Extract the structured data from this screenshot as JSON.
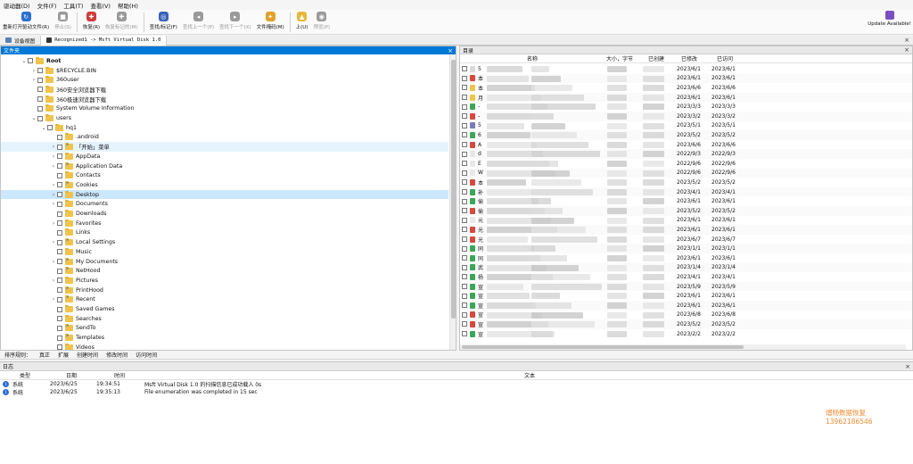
{
  "menu": [
    "驱动器(D)",
    "文件(F)",
    "工具(T)",
    "查看(V)",
    "帮助(H)"
  ],
  "toolbar": [
    {
      "label": "重新打开驱动文件(R)",
      "icon": "refresh-icon",
      "color": "#2a6fd1",
      "enabled": true
    },
    {
      "label": "停止(S)",
      "icon": "stop-icon",
      "color": "#9a9a9a",
      "enabled": false
    },
    {
      "label": "恢复(R)",
      "icon": "recover-icon",
      "color": "#d23b3b",
      "enabled": true
    },
    {
      "label": "恢复标记的(M)",
      "icon": "recover-marked-icon",
      "color": "#9a9a9a",
      "enabled": false
    },
    {
      "label": "查找/标记(F)",
      "icon": "binoculars-icon",
      "color": "#3a62b8",
      "enabled": true
    },
    {
      "label": "查找上一个(P)",
      "icon": "find-prev-icon",
      "color": "#9a9a9a",
      "enabled": false
    },
    {
      "label": "查找下一个(X)",
      "icon": "find-next-icon",
      "color": "#9a9a9a",
      "enabled": false
    },
    {
      "label": "文件掩码(M)",
      "icon": "file-mask-icon",
      "color": "#e0a22c",
      "enabled": true
    },
    {
      "label": "上(U)",
      "icon": "folder-up-icon",
      "color": "#e8b83c",
      "enabled": true
    },
    {
      "label": "预览(P)",
      "icon": "preview-icon",
      "color": "#9a9a9a",
      "enabled": false
    }
  ],
  "update_label": "Update Available!",
  "tabs": [
    {
      "label": "设备视图",
      "active": false
    },
    {
      "label": "Recognized1 -> Msft Virtual Disk 1.0",
      "active": true
    }
  ],
  "tree": {
    "title": "文件夹",
    "rows": [
      {
        "label": "Root",
        "level": 0,
        "arrow": "⌄",
        "bold": true
      },
      {
        "label": "$RECYCLE.BIN",
        "level": 1,
        "arrow": "›"
      },
      {
        "label": "360user",
        "level": 1,
        "arrow": "›"
      },
      {
        "label": "360安全浏览器下载",
        "level": 1,
        "arrow": ""
      },
      {
        "label": "360极速浏览器下载",
        "level": 1,
        "arrow": ""
      },
      {
        "label": "System Volume Information",
        "level": 1,
        "arrow": ""
      },
      {
        "label": "users",
        "level": 1,
        "arrow": "⌄"
      },
      {
        "label": "hq1",
        "level": 2,
        "arrow": "⌄"
      },
      {
        "label": ".android",
        "level": 3,
        "arrow": ""
      },
      {
        "label": "「开始」菜单",
        "level": 3,
        "arrow": "›",
        "state": "hov",
        "link": true
      },
      {
        "label": "AppData",
        "level": 3,
        "arrow": "›"
      },
      {
        "label": "Application Data",
        "level": 3,
        "arrow": "›",
        "link": true
      },
      {
        "label": "Contacts",
        "level": 3,
        "arrow": ""
      },
      {
        "label": "Cookies",
        "level": 3,
        "arrow": "›",
        "link": true
      },
      {
        "label": "Desktop",
        "level": 3,
        "arrow": "›",
        "state": "sel"
      },
      {
        "label": "Documents",
        "level": 3,
        "arrow": "›"
      },
      {
        "label": "Downloads",
        "level": 3,
        "arrow": ""
      },
      {
        "label": "Favorites",
        "level": 3,
        "arrow": "›"
      },
      {
        "label": "Links",
        "level": 3,
        "arrow": ""
      },
      {
        "label": "Local Settings",
        "level": 3,
        "arrow": "›",
        "link": true
      },
      {
        "label": "Music",
        "level": 3,
        "arrow": ""
      },
      {
        "label": "My Documents",
        "level": 3,
        "arrow": "›",
        "link": true
      },
      {
        "label": "NetHood",
        "level": 3,
        "arrow": "",
        "link": true
      },
      {
        "label": "Pictures",
        "level": 3,
        "arrow": "›"
      },
      {
        "label": "PrintHood",
        "level": 3,
        "arrow": "",
        "link": true
      },
      {
        "label": "Recent",
        "level": 3,
        "arrow": "›",
        "link": true
      },
      {
        "label": "Saved Games",
        "level": 3,
        "arrow": ""
      },
      {
        "label": "Searches",
        "level": 3,
        "arrow": ""
      },
      {
        "label": "SendTo",
        "level": 3,
        "arrow": "",
        "link": true
      },
      {
        "label": "Templates",
        "level": 3,
        "arrow": "",
        "link": true
      },
      {
        "label": "Videos",
        "level": 3,
        "arrow": ""
      }
    ]
  },
  "files": {
    "title": "目录",
    "columns": {
      "name": "名称",
      "size": "大小，字节",
      "created": "已创建",
      "modified": "已修改",
      "accessed": "已访问"
    },
    "rows": [
      {
        "initial": "5",
        "icon": "#d9d9d9",
        "modified": "2023/6/1",
        "accessed": "2023/6/1"
      },
      {
        "initial": "本",
        "icon": "#d8483c",
        "modified": "2023/6/1",
        "accessed": "2023/6/1"
      },
      {
        "initial": "本",
        "icon": "#f0c44c",
        "modified": "2023/6/6",
        "accessed": "2023/6/6"
      },
      {
        "initial": "月",
        "icon": "#f0c44c",
        "modified": "2023/6/1",
        "accessed": "2023/6/1"
      },
      {
        "initial": "-",
        "icon": "#3aa657",
        "modified": "2023/3/3",
        "accessed": "2023/3/3"
      },
      {
        "initial": "-",
        "icon": "#d8483c",
        "modified": "2023/3/2",
        "accessed": "2023/3/2"
      },
      {
        "initial": "5",
        "icon": "#7a7ab8",
        "modified": "2023/5/1",
        "accessed": "2023/5/1"
      },
      {
        "initial": "6",
        "icon": "#3aa657",
        "modified": "2023/5/2",
        "accessed": "2023/5/2"
      },
      {
        "initial": "A",
        "icon": "#d8483c",
        "modified": "2023/6/6",
        "accessed": "2023/6/6"
      },
      {
        "initial": "d",
        "icon": "#e8e8e8",
        "modified": "2022/9/3",
        "accessed": "2022/9/3"
      },
      {
        "initial": "E",
        "icon": "#e8e8e8",
        "modified": "2022/9/6",
        "accessed": "2022/9/6"
      },
      {
        "initial": "W",
        "icon": "#e8e8e8",
        "modified": "2022/9/6",
        "accessed": "2022/9/6"
      },
      {
        "initial": "本",
        "icon": "#d8483c",
        "modified": "2023/5/2",
        "accessed": "2023/5/2"
      },
      {
        "initial": "补",
        "icon": "#3aa657",
        "modified": "2023/4/1",
        "accessed": "2023/4/1"
      },
      {
        "initial": "偷",
        "icon": "#3aa657",
        "modified": "2023/6/1",
        "accessed": "2023/6/1"
      },
      {
        "initial": "偷",
        "icon": "#d8483c",
        "modified": "2023/5/2",
        "accessed": "2023/5/2"
      },
      {
        "initial": "元",
        "icon": "#e8e8e8",
        "modified": "2023/6/1",
        "accessed": "2023/6/1"
      },
      {
        "initial": "光",
        "icon": "#d8483c",
        "modified": "2023/6/1",
        "accessed": "2023/6/1"
      },
      {
        "initial": "光",
        "icon": "#d8483c",
        "modified": "2023/6/7",
        "accessed": "2023/6/7"
      },
      {
        "initial": "同",
        "icon": "#3aa657",
        "modified": "2023/1/1",
        "accessed": "2023/1/1"
      },
      {
        "initial": "同",
        "icon": "#3aa657",
        "modified": "2023/6/1",
        "accessed": "2023/6/1"
      },
      {
        "initial": "武",
        "icon": "#3aa657",
        "modified": "2023/1/4",
        "accessed": "2023/1/4"
      },
      {
        "initial": "杨",
        "icon": "#3aa657",
        "modified": "2023/4/1",
        "accessed": "2023/4/1"
      },
      {
        "initial": "宣",
        "icon": "#3aa657",
        "modified": "2023/5/9",
        "accessed": "2023/5/9"
      },
      {
        "initial": "宣",
        "icon": "#3aa657",
        "modified": "2023/6/1",
        "accessed": "2023/6/1"
      },
      {
        "initial": "宣",
        "icon": "#3aa657",
        "modified": "2023/6/1",
        "accessed": "2023/6/1"
      },
      {
        "initial": "宣",
        "icon": "#d8483c",
        "modified": "2023/6/8",
        "accessed": "2023/6/8"
      },
      {
        "initial": "宣",
        "icon": "#d8483c",
        "modified": "2023/5/2",
        "accessed": "2023/5/2"
      },
      {
        "initial": "宣",
        "icon": "#3aa657",
        "modified": "2023/2/2",
        "accessed": "2023/2/2"
      }
    ]
  },
  "sort": {
    "label": "排序规则：",
    "options": [
      "真正",
      "扩展",
      "创建时间",
      "修改时间",
      "访问时间"
    ]
  },
  "log": {
    "title": "日志",
    "columns": {
      "type": "类型",
      "date": "日期",
      "time": "时间",
      "text": "文本"
    },
    "rows": [
      {
        "type": "系统",
        "date": "2023/6/25",
        "time": "19:34:51",
        "text": "Msft Virtual Disk 1.0 的扫描信息已成功载入 0s"
      },
      {
        "type": "系统",
        "date": "2023/6/25",
        "time": "19:35:13",
        "text": "File enumeration was completed in 15 sec"
      }
    ]
  },
  "watermark": {
    "line1": "熠旸数据恢复",
    "line2": "13962186546"
  }
}
